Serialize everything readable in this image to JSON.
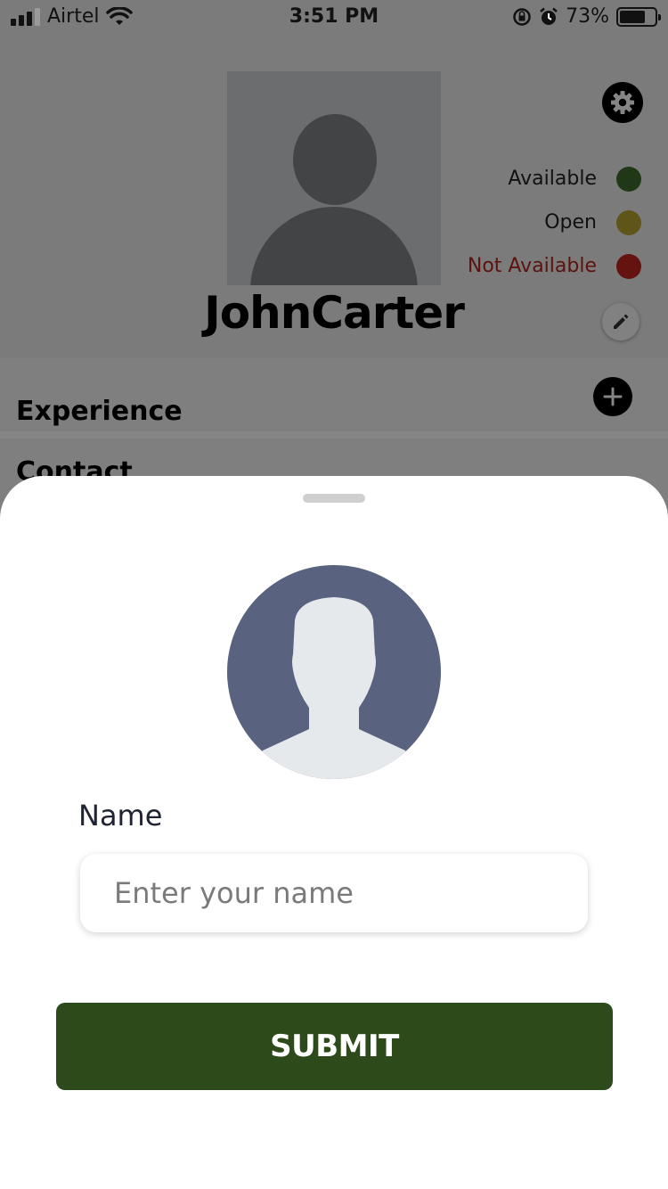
{
  "status_bar": {
    "carrier": "Airtel",
    "time": "3:51 PM",
    "battery": "73%",
    "battery_level": 0.73
  },
  "profile": {
    "name": "JohnCarter"
  },
  "status_legend": [
    {
      "label": "Available",
      "color": "#3f6b2a",
      "text_color": "#222222"
    },
    {
      "label": "Open",
      "color": "#b8a431",
      "text_color": "#222222"
    },
    {
      "label": "Not Available",
      "color": "#c0261f",
      "text_color": "#b0261e"
    }
  ],
  "sections": {
    "experience": "Experience",
    "contact": "Contact"
  },
  "sheet": {
    "name_label": "Name",
    "name_placeholder": "Enter your name",
    "name_value": "",
    "submit_label": "SUBMIT"
  },
  "icons": {
    "settings": "gear-icon",
    "edit": "pencil-icon",
    "add": "plus-icon"
  },
  "colors": {
    "submit_bg": "#2d4a1b",
    "avatar_bg": "#59627f"
  }
}
